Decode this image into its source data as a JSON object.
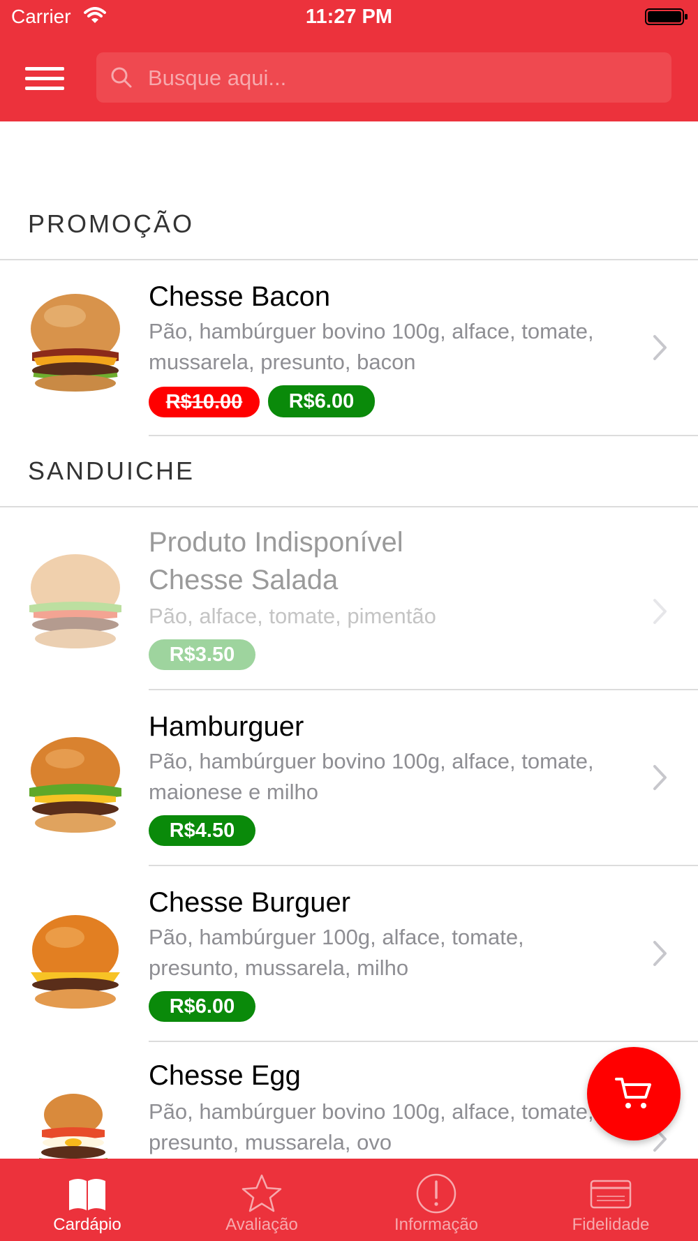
{
  "status_bar": {
    "carrier": "Carrier",
    "time": "11:27 PM"
  },
  "search": {
    "placeholder": "Busque aqui..."
  },
  "sections": [
    {
      "title": "PROMOÇÃO",
      "items": [
        {
          "name": "Chesse Bacon",
          "description": "Pão, hambúrguer bovino 100g, alface, tomate, mussarela, presunto, bacon",
          "old_price": "R$10.00",
          "price": "R$6.00"
        }
      ]
    },
    {
      "title": "SANDUICHE",
      "items": [
        {
          "status": "Produto Indisponível",
          "name": "Chesse Salada",
          "description": "Pão, alface, tomate, pimentão",
          "price": "R$3.50"
        },
        {
          "name": "Hamburguer",
          "description": "Pão, hambúrguer bovino 100g, alface, tomate, maionese e milho",
          "price": "R$4.50"
        },
        {
          "name": "Chesse Burguer",
          "description": "Pão, hambúrguer 100g, alface, tomate, presunto, mussarela, milho",
          "price": "R$6.00"
        },
        {
          "name": "Chesse Egg",
          "description": "Pão, hambúrguer bovino 100g, alface, tomate, presunto, mussarela, ovo"
        }
      ]
    }
  ],
  "tabs": [
    {
      "label": "Cardápio",
      "icon": "book-icon",
      "active": true
    },
    {
      "label": "Avaliação",
      "icon": "star-icon"
    },
    {
      "label": "Informação",
      "icon": "info-icon"
    },
    {
      "label": "Fidelidade",
      "icon": "card-icon"
    }
  ],
  "colors": {
    "header": "#EC323C",
    "price_new": "#0A8A0A",
    "price_old": "#FF0000",
    "cart": "#FF0000"
  }
}
